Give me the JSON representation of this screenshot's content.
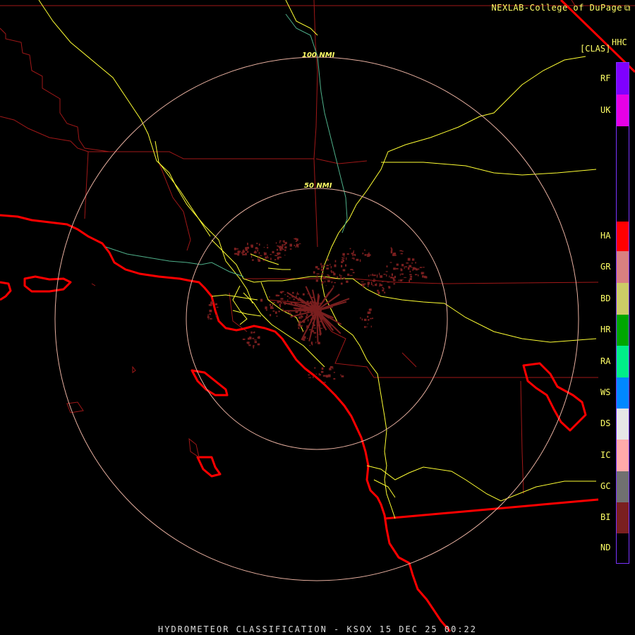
{
  "header": {
    "credit": "NEXLAB-College of DuPage",
    "credit_icon": "external-link-icon",
    "product": "HHC",
    "mode": "[CLAS]"
  },
  "footer": {
    "title": "HYDROMETEOR CLASSIFICATION - KSOX 15 DEC 25 00:22"
  },
  "range_rings": [
    {
      "label": "50 NMI"
    },
    {
      "label": "100 NMI"
    }
  ],
  "legend": [
    {
      "code": "RF",
      "color": "#7f00ff"
    },
    {
      "code": "UK",
      "color": "#e600e6"
    },
    {
      "code": "HA",
      "color": "#ff0000"
    },
    {
      "code": "GR",
      "color": "#d98080"
    },
    {
      "code": "BD",
      "color": "#cccc66"
    },
    {
      "code": "HR",
      "color": "#00a600"
    },
    {
      "code": "RA",
      "color": "#00ee88"
    },
    {
      "code": "WS",
      "color": "#0088ff"
    },
    {
      "code": "DS",
      "color": "#e6e6e6"
    },
    {
      "code": "IC",
      "color": "#ffaaaa"
    },
    {
      "code": "GC",
      "color": "#707070"
    },
    {
      "code": "BI",
      "color": "#7a1f1f"
    },
    {
      "code": "ND",
      "color": "#000000"
    }
  ],
  "colors": {
    "coastline": "#ff0000",
    "county_lines": "#a01818",
    "highways": "#ffff33",
    "rings": "#e8b0a0",
    "echo": "#7a1f1f"
  }
}
